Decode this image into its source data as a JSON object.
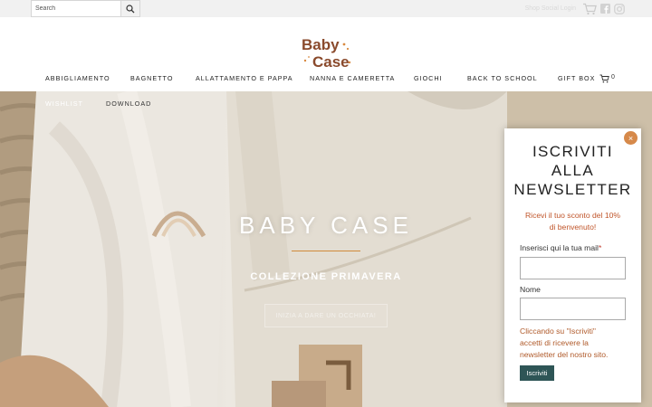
{
  "topbar": {
    "search_placeholder": "Search",
    "right_text": "Shop Social Login",
    "icons": [
      "search-icon",
      "cart-icon",
      "facebook-icon",
      "instagram-icon"
    ]
  },
  "logo": {
    "line1": "Baby",
    "line2": "Case",
    "brand_color": "#8a4a2c"
  },
  "nav": {
    "items": [
      "ABBIGLIAMENTO",
      "BAGNETTO",
      "ALLATTAMENTO E PAPPA",
      "NANNA E CAMERETTA",
      "GIOCHI",
      "BACK TO SCHOOL",
      "GIFT BOX",
      "WISHLIST",
      "DOWNLOAD"
    ],
    "cart_count": "0"
  },
  "hero": {
    "title": "BABY CASE",
    "subtitle": "COLLEZIONE PRIMAVERA",
    "cta": "INIZIA A DARE UN OCCHIATA!",
    "accent_color": "#d08a3a"
  },
  "newsletter": {
    "close": "×",
    "title_line1": "ISCRIVITI",
    "title_line2": "ALLA",
    "title_line3": "NEWSLETTER",
    "promo_line1": "Ricevi il tuo sconto del 10%",
    "promo_line2": "di benvenuto!",
    "email_label": "Inserisci qui la tua mail",
    "email_required": "*",
    "email_value": "",
    "name_label": "Nome",
    "name_value": "",
    "disclaimer_line1": "Cliccando su \"Iscriviti\"",
    "disclaimer_line2": "accetti di ricevere la",
    "disclaimer_line3": "newsletter del nostro sito.",
    "submit": "Iscriviti",
    "button_color": "#2e5556"
  }
}
